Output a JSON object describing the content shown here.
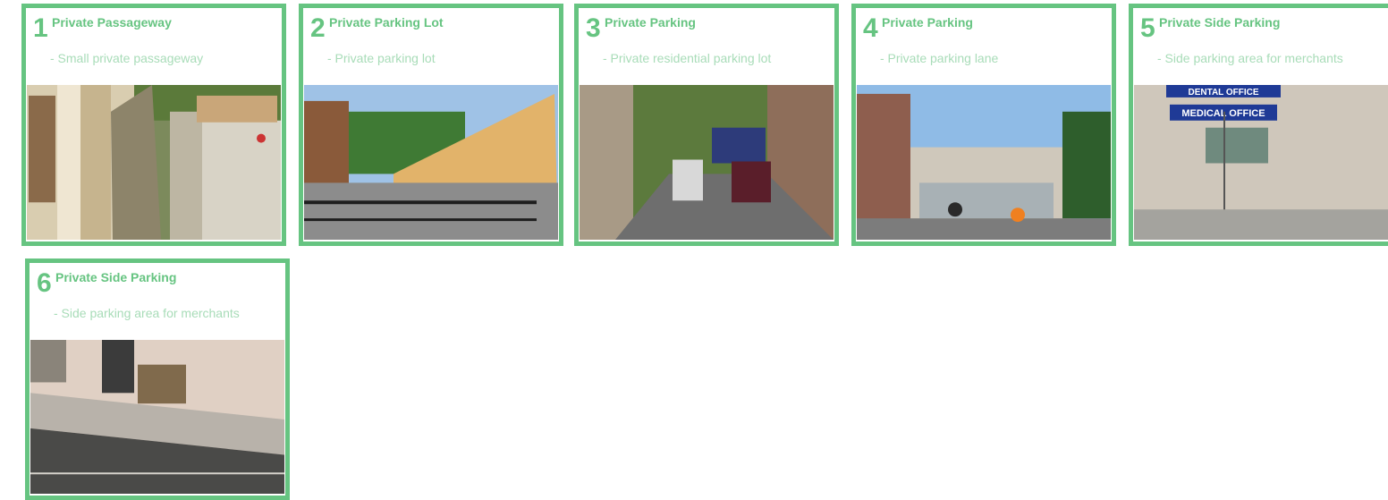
{
  "cards": [
    {
      "number": "1",
      "title": "Private Passageway",
      "description": "- Small private passageway",
      "photo": "alley-passageway-photo"
    },
    {
      "number": "2",
      "title": "Private Parking Lot",
      "description": "- Private parking lot",
      "photo": "temple-parking-lot-photo"
    },
    {
      "number": "3",
      "title": "Private Parking",
      "description": "- Private residential parking lot",
      "photo": "residential-parking-photo"
    },
    {
      "number": "4",
      "title": "Private Parking",
      "description": "- Private parking lane",
      "photo": "parking-lane-photo"
    },
    {
      "number": "5",
      "title": "Private Side Parking",
      "description": "- Side parking area for merchants",
      "photo": "dental-office-side-parking-photo",
      "signs": [
        "DENTAL OFFICE",
        "MEDICAL OFFICE"
      ]
    },
    {
      "number": "6",
      "title": "Private Side Parking",
      "description": "- Side parking area for merchants",
      "photo": "merchant-side-parking-photo"
    }
  ],
  "colors": {
    "accent": "#66c481",
    "description": "#a8dcb8"
  }
}
